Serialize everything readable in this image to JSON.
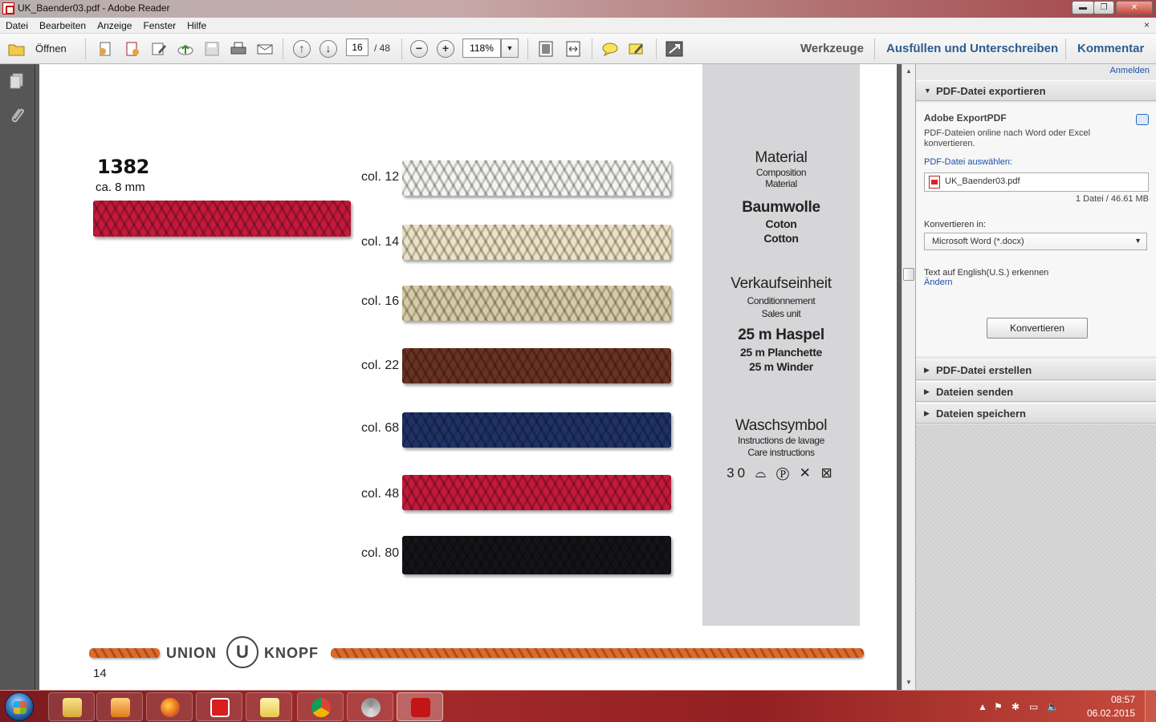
{
  "window": {
    "title": "UK_Baender03.pdf - Adobe Reader",
    "min_label": "▬",
    "max_label": "❐",
    "close_label": "✕"
  },
  "menu": {
    "items": [
      "Datei",
      "Bearbeiten",
      "Anzeige",
      "Fenster",
      "Hilfe"
    ],
    "close_doc": "×"
  },
  "toolbar": {
    "open_label": "Öffnen",
    "page_current": "16",
    "page_total": "/ 48",
    "zoom": "118%",
    "tools_label": "Werkzeuge",
    "fill_sign_label": "Ausfüllen und Unterschreiben",
    "comment_label": "Kommentar"
  },
  "document": {
    "product_number": "1382",
    "product_size": "ca. 8 mm",
    "colors": [
      {
        "label": "col. 12",
        "hex": "#f4f4f2"
      },
      {
        "label": "col. 14",
        "hex": "#ece2c5"
      },
      {
        "label": "col. 16",
        "hex": "#d8cca6"
      },
      {
        "label": "col. 22",
        "hex": "#6a3222"
      },
      {
        "label": "col. 68",
        "hex": "#1f3268"
      },
      {
        "label": "col. 48",
        "hex": "#c5193b"
      },
      {
        "label": "col. 80",
        "hex": "#141418"
      }
    ],
    "sample_hex": "#c5193b",
    "info": {
      "material_title": "Material",
      "material_sub1": "Composition",
      "material_sub2": "Material",
      "material_value1": "Baumwolle",
      "material_value2": "Coton",
      "material_value3": "Cotton",
      "unit_title": "Verkaufseinheit",
      "unit_sub1": "Conditionnement",
      "unit_sub2": "Sales unit",
      "unit_value1": "25 m Haspel",
      "unit_value2": "25 m Planchette",
      "unit_value3": "25 m Winder",
      "wash_title": "Waschsymbol",
      "wash_sub1": "Instructions de lavage",
      "wash_sub2": "Care instructions",
      "wash_icons": "30 ⌓ Ⓟ ✕ ⊠"
    },
    "brand_left": "UNION",
    "brand_logo_letter": "U",
    "brand_right": "KNOPF",
    "footer_rope_hex": "#e06a2a",
    "page_number": "14"
  },
  "right_panel": {
    "signin": "Anmelden",
    "export_section": "PDF-Datei exportieren",
    "export_title": "Adobe ExportPDF",
    "export_desc1": "PDF-Dateien online nach Word oder Excel",
    "export_desc2": "konvertieren.",
    "select_file_label": "PDF-Datei auswählen:",
    "file_name": "UK_Baender03.pdf",
    "file_info": "1 Datei / 46.61 MB",
    "convert_to_label": "Konvertieren in:",
    "convert_to_value": "Microsoft Word (*.docx)",
    "ocr_text": "Text auf English(U.S.) erkennen",
    "change_link": "Ändern",
    "convert_button": "Konvertieren",
    "create_section": "PDF-Datei erstellen",
    "send_section": "Dateien senden",
    "save_section": "Dateien speichern"
  },
  "taskbar": {
    "time": "08:57",
    "date": "06.02.2015"
  }
}
